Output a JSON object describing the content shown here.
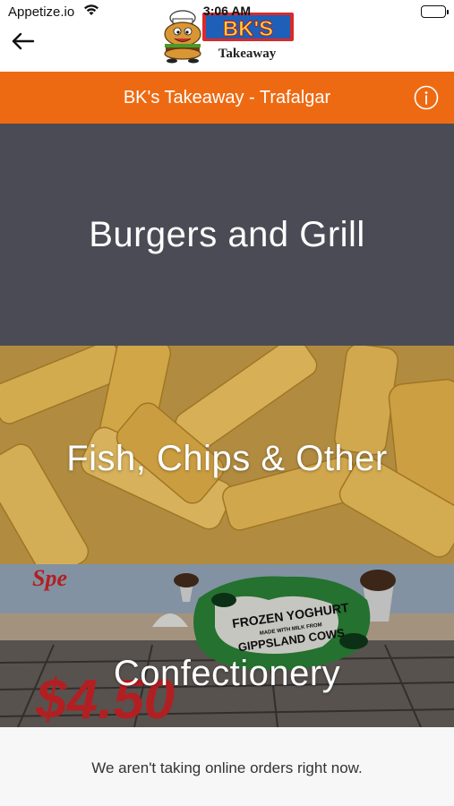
{
  "status_bar": {
    "carrier": "Appetize.io",
    "time": "3:06 AM"
  },
  "header": {
    "back_icon": "arrow-left-icon",
    "logo": {
      "brand": "BK'S",
      "sub": "Takeaway"
    }
  },
  "title_bar": {
    "title": "BK's Takeaway - Trafalgar",
    "info_icon": "info-circle-icon",
    "color": "#ee6a12"
  },
  "categories": [
    {
      "label": "Burgers and Grill"
    },
    {
      "label": "Fish, Chips & Other"
    },
    {
      "label": "Confectionery",
      "promo": {
        "special_text": "Spe",
        "price": "$4.50",
        "banner_line1": "FROZEN YOGHURT",
        "banner_line2": "MADE WITH MILK FROM",
        "banner_line3": "GIPPSLAND COWS"
      }
    }
  ],
  "notice": {
    "text": "We aren't taking online orders right now."
  }
}
